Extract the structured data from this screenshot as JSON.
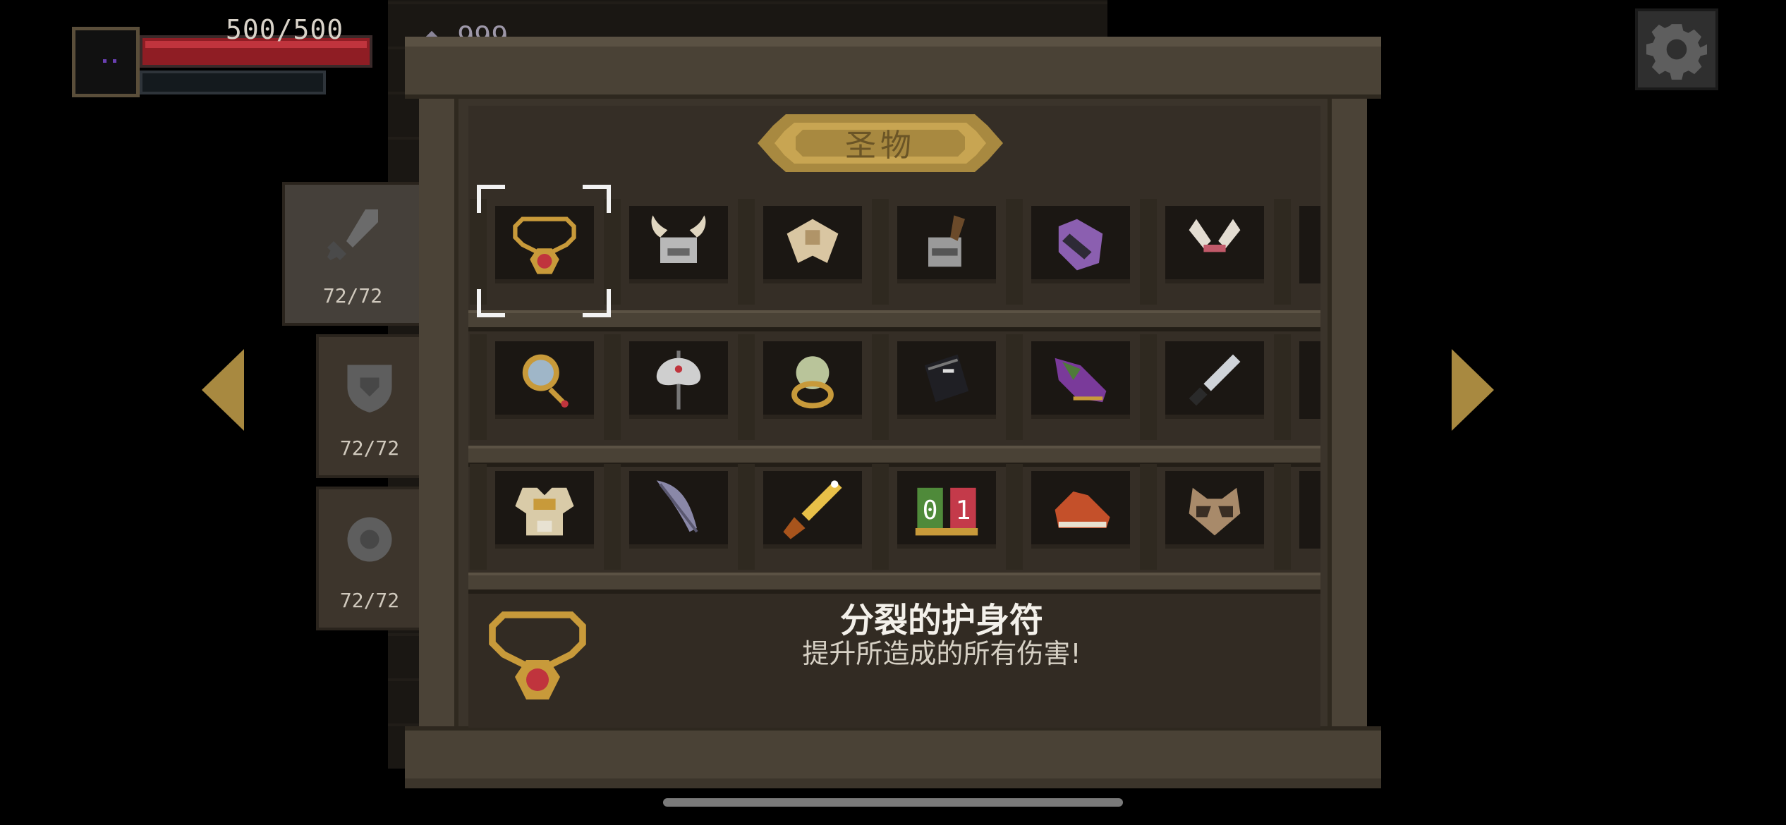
{
  "hud": {
    "hp_text": "500/500",
    "hp_fraction": 1.0,
    "gem_text": "999"
  },
  "panel": {
    "title": "圣物"
  },
  "side_tabs": [
    {
      "icon": "sword-icon",
      "count": "72/72"
    },
    {
      "icon": "shield-icon",
      "count": "72/72"
    },
    {
      "icon": "orb-icon",
      "count": "72/72"
    }
  ],
  "relics": {
    "rows": [
      [
        "amulet-icon",
        "horned-helmet-icon",
        "paper-charm-icon",
        "axe-helmet-icon",
        "cursed-bone-icon",
        "bunny-ears-icon"
      ],
      [
        "magic-mirror-icon",
        "double-axe-icon",
        "crystal-ring-icon",
        "black-book-icon",
        "purple-shoe-icon",
        "dagger-icon"
      ],
      [
        "gold-armor-icon",
        "feather-quill-icon",
        "golden-sword-icon",
        "counter-01-icon",
        "red-sneaker-icon",
        "raccoon-mask-icon"
      ]
    ],
    "counter_digits": [
      "0",
      "1"
    ]
  },
  "selected": {
    "name": "分裂的护身符",
    "description": "提升所造成的所有伤害!"
  },
  "colors": {
    "gold": "#a88940",
    "hp_red": "#8f1d24",
    "wood": "#4a4236"
  }
}
